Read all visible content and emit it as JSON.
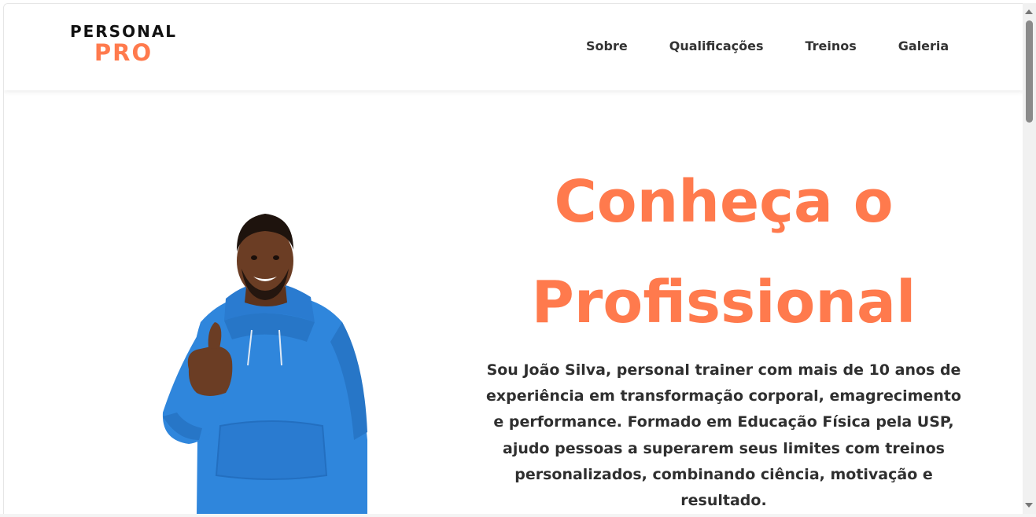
{
  "logo": {
    "top": "PERSONAL",
    "bottom": "PRO"
  },
  "nav": {
    "items": [
      "Sobre",
      "Qualificações",
      "Treinos",
      "Galeria"
    ]
  },
  "hero": {
    "title": "Conheça o Profissional",
    "description": "Sou João Silva, personal trainer com mais de 10 anos de experiência em transformação corporal, emagrecimento e performance. Formado em Educação Física pela USP, ajudo pessoas a superarem seus limites com treinos personalizados, combinando ciência, motivação e resultado.",
    "photo_icon": "trainer-photo"
  },
  "colors": {
    "accent": "#ff7a4d",
    "text": "#2f2f2f",
    "hoodie": "#2f86dc",
    "skin": "#6b3d24"
  }
}
